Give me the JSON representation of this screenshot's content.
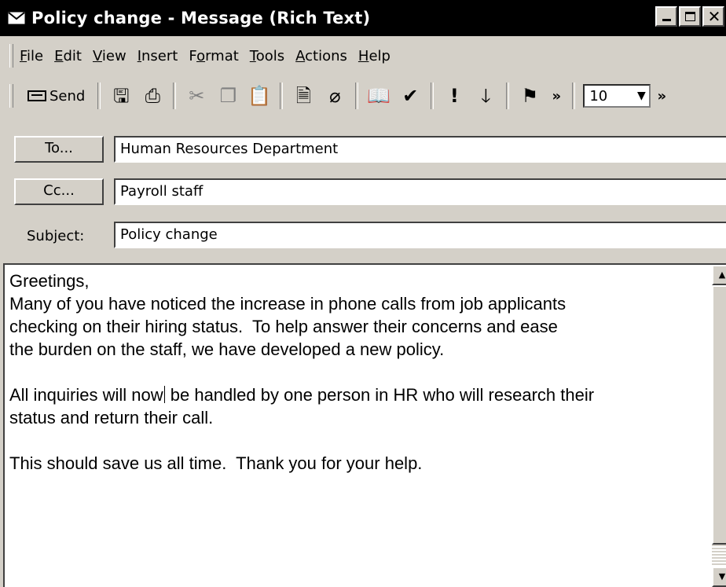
{
  "window": {
    "title": "Policy change - Message (Rich Text)"
  },
  "menu": {
    "items": [
      {
        "label": "File",
        "accel": "F"
      },
      {
        "label": "Edit",
        "accel": "E"
      },
      {
        "label": "View",
        "accel": "V"
      },
      {
        "label": "Insert",
        "accel": "I"
      },
      {
        "label": "Format",
        "accel": "o"
      },
      {
        "label": "Tools",
        "accel": "T"
      },
      {
        "label": "Actions",
        "accel": "A"
      },
      {
        "label": "Help",
        "accel": "H"
      }
    ]
  },
  "toolbar": {
    "send_label": "Send",
    "font_size": "10",
    "icons": [
      "save-icon",
      "print-icon",
      "cut-icon",
      "copy-icon",
      "paste-icon",
      "insert-file-icon",
      "attach-icon",
      "address-book-icon",
      "check-names-icon",
      "high-importance-icon",
      "low-importance-icon",
      "flag-icon"
    ]
  },
  "header": {
    "to_button": "To...",
    "to_value": "Human Resources Department",
    "cc_button": "Cc...",
    "cc_value": "Payroll staff",
    "subject_label": "Subject:",
    "subject_value": "Policy change"
  },
  "message": {
    "line1": "Greetings,",
    "line2": "Many of you have noticed the increase in phone calls from job applicants",
    "line3": "checking on their hiring status.  To help answer their concerns and ease",
    "line4": "the burden on the staff, we have developed a new policy.",
    "line5a": "All inquiries will now",
    "line5b": " be handled by one person in HR who will research their",
    "line6": "status and return their call.",
    "line7": "This should save us all time.  Thank you for your help."
  }
}
